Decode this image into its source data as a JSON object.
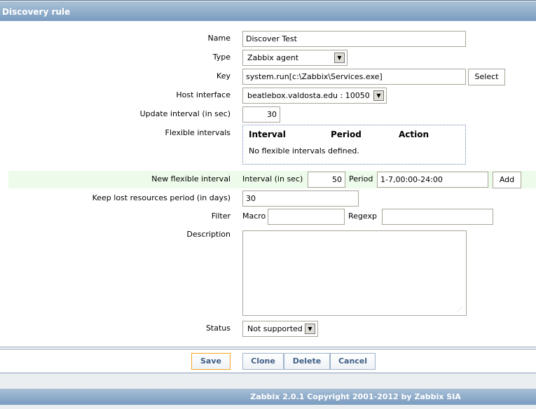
{
  "header": {
    "title": "Discovery rule"
  },
  "form": {
    "name": {
      "label": "Name",
      "value": "Discover Test"
    },
    "type": {
      "label": "Type",
      "value": "Zabbix agent"
    },
    "key": {
      "label": "Key",
      "value": "system.run[c:\\Zabbix\\Services.exe]",
      "button": "Select"
    },
    "host_interface": {
      "label": "Host interface",
      "value": "beatlebox.valdosta.edu : 10050"
    },
    "update_interval": {
      "label": "Update interval (in sec)",
      "value": "30"
    },
    "flexible_intervals": {
      "label": "Flexible intervals",
      "columns": [
        "Interval",
        "Period",
        "Action"
      ],
      "empty": "No flexible intervals defined."
    },
    "new_flexible": {
      "label": "New flexible interval",
      "interval_label": "Interval (in sec)",
      "interval_value": "50",
      "period_label": "Period",
      "period_value": "1-7,00:00-24:00",
      "add": "Add"
    },
    "keep_lost": {
      "label": "Keep lost resources period (in days)",
      "value": "30"
    },
    "filter": {
      "label": "Filter",
      "macro_label": "Macro",
      "macro_value": "",
      "regexp_label": "Regexp",
      "regexp_value": ""
    },
    "description": {
      "label": "Description",
      "value": ""
    },
    "status": {
      "label": "Status",
      "value": "Not supported"
    }
  },
  "buttons": {
    "save": "Save",
    "clone": "Clone",
    "delete": "Delete",
    "cancel": "Cancel"
  },
  "footer": {
    "text": "Zabbix 2.0.1 Copyright 2001-2012 by Zabbix SIA"
  }
}
